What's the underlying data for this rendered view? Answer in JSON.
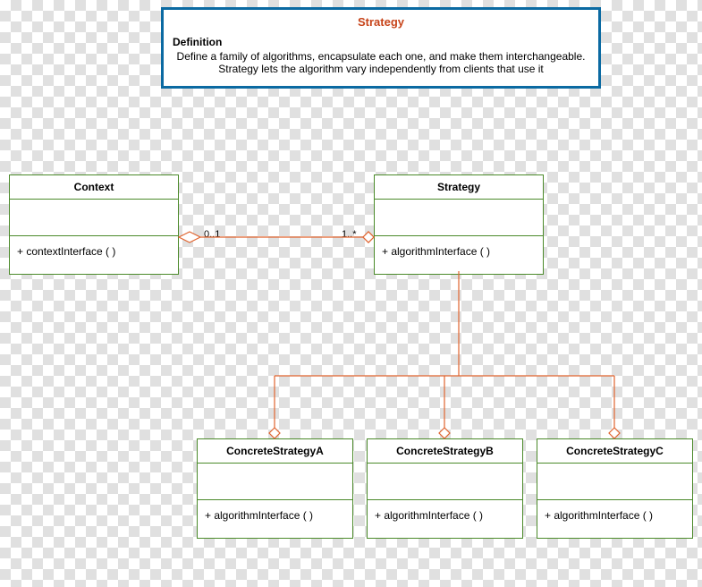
{
  "title_box": {
    "title": "Strategy",
    "definition_label": "Definition",
    "definition_text": "Define a family of algorithms, encapsulate each one, and make them interchangeable. Strategy lets the algorithm vary independently from clients that use it"
  },
  "classes": {
    "context": {
      "name": "Context",
      "operation": "+ contextInterface ( )"
    },
    "strategy": {
      "name": "Strategy",
      "operation": "+ algorithmInterface ( )"
    },
    "concreteA": {
      "name": "ConcreteStrategyA",
      "operation": "+ algorithmInterface ( )"
    },
    "concreteB": {
      "name": "ConcreteStrategyB",
      "operation": "+ algorithmInterface ( )"
    },
    "concreteC": {
      "name": "ConcreteStrategyC",
      "operation": "+ algorithmInterface ( )"
    }
  },
  "associations": {
    "context_strategy": {
      "left_multiplicity": "0..1",
      "right_multiplicity": "1..*"
    }
  }
}
